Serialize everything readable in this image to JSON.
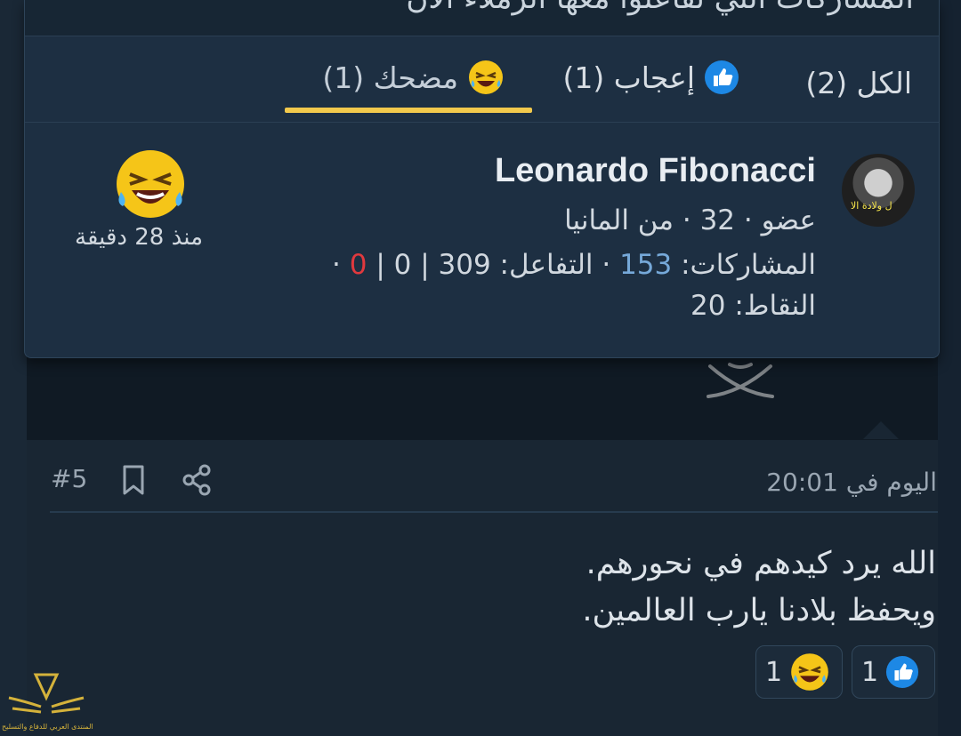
{
  "popup": {
    "title": "المشاركات التي تفاعلوا معها الزملاء الأن",
    "tabs": [
      {
        "label": "الكل (2)",
        "icon": "none"
      },
      {
        "label": "إعجاب (1)",
        "icon": "like-icon"
      },
      {
        "label": "مضحك (1)",
        "icon": "haha-icon"
      }
    ],
    "active_tab": "مضحك (1)",
    "reactor": {
      "name": "Leonardo Fibonacci",
      "meta": "عضو · 32 · من المانيا",
      "stats_prefix": "المشاركات:",
      "posts": "153",
      "reactions_label": "· التفاعل:",
      "reactions": "309 | 0 |",
      "negative": "0",
      "tail": "·",
      "points_label": "النقاط:",
      "points": "20",
      "avatar_caption": "ل ولادة الا",
      "reaction_time": "منذ 28 دقيقة"
    }
  },
  "post": {
    "date": "اليوم في 20:01",
    "number": "#5",
    "body_line1": "الله يرد كيدهم في نحورهم.",
    "body_line2": "ويحفظ بلادنا يارب العالمين.",
    "like_count": "1",
    "haha_count": "1"
  },
  "logo": {
    "text": "المنتدى العربي للدفاع والتسليح"
  },
  "colors": {
    "accent_underline": "#f2c94c",
    "like_blue": "#1d88e5",
    "haha_yellow": "#f5c518",
    "negative_red": "#e0393e"
  }
}
